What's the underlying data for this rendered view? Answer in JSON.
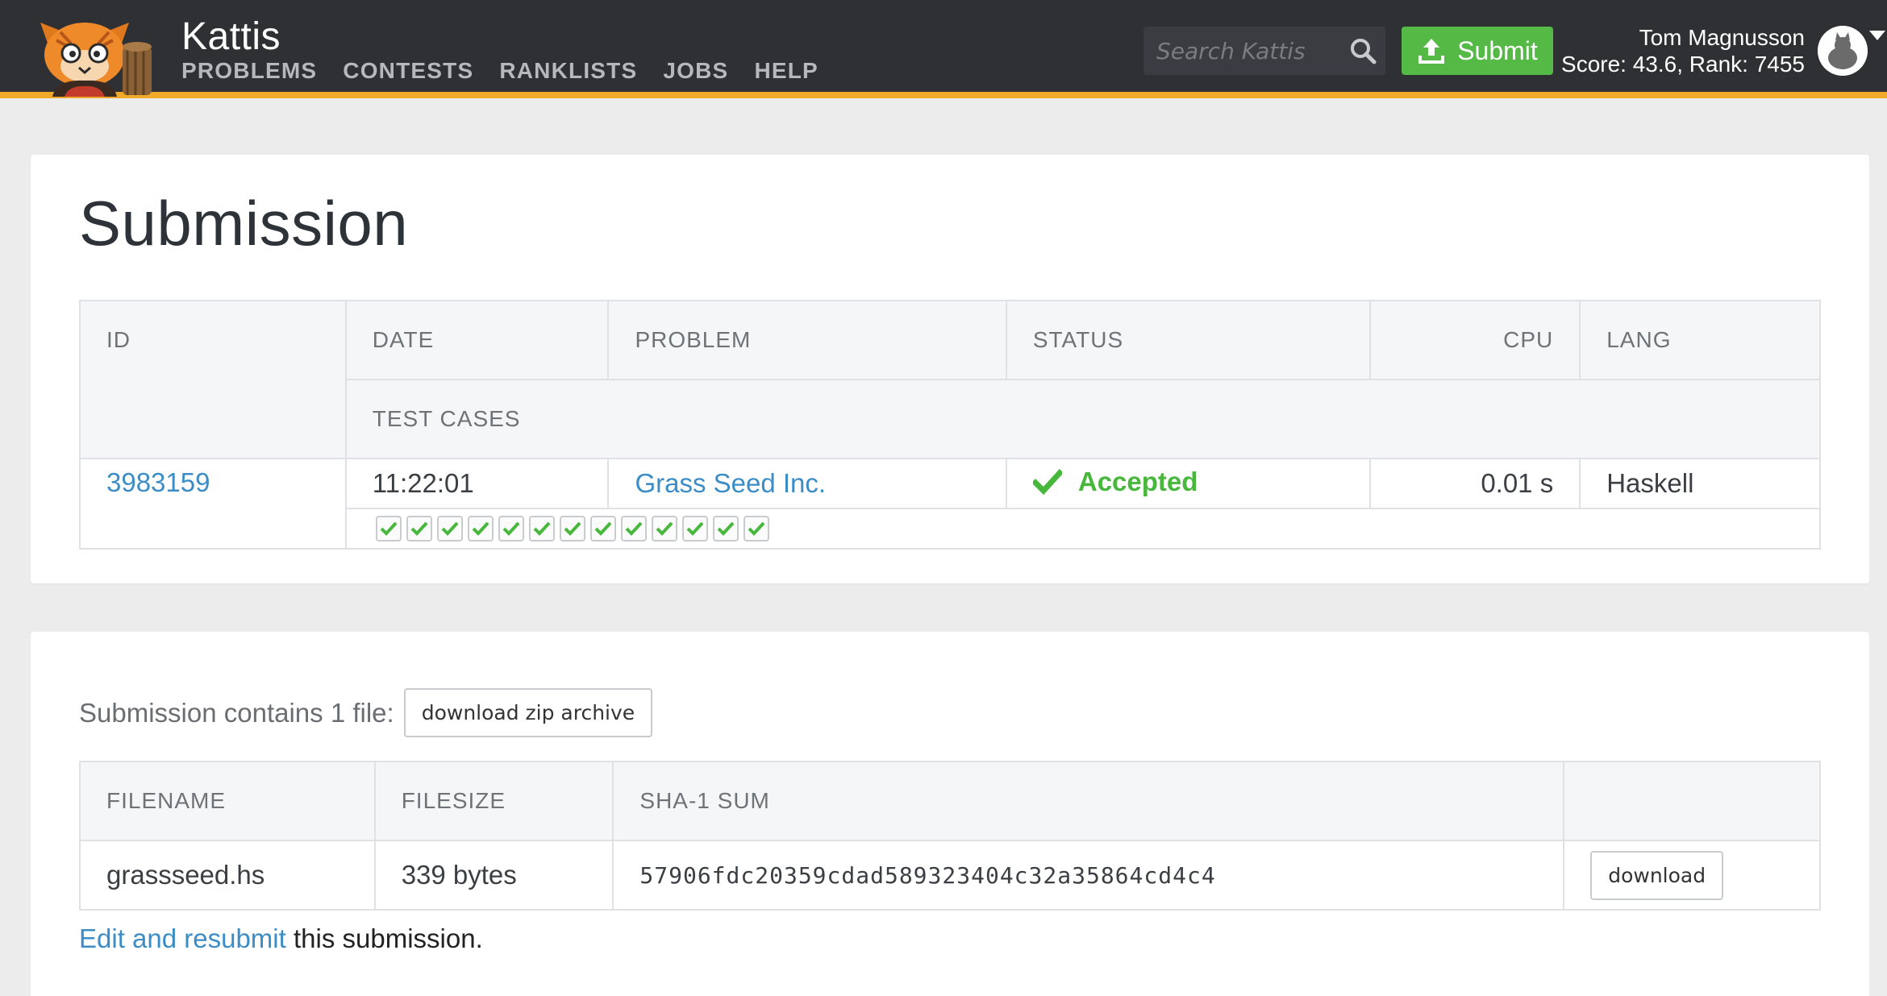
{
  "header": {
    "brand": "Kattis",
    "nav": [
      "PROBLEMS",
      "CONTESTS",
      "RANKLISTS",
      "JOBS",
      "HELP"
    ],
    "search_placeholder": "Search Kattis",
    "submit_label": "Submit",
    "user_name": "Tom Magnusson",
    "user_score": "Score: 43.6, Rank: 7455",
    "accent_color": "#f0a928",
    "submit_color": "#55b946"
  },
  "submission": {
    "title": "Submission",
    "columns": {
      "id": "ID",
      "date": "DATE",
      "problem": "PROBLEM",
      "status": "STATUS",
      "cpu": "CPU",
      "lang": "LANG",
      "test_cases": "TEST CASES"
    },
    "row": {
      "id": "3983159",
      "date": "11:22:01",
      "problem": "Grass Seed Inc.",
      "status": "Accepted",
      "cpu": "0.01 s",
      "lang": "Haskell"
    },
    "test_cases_passed": 13,
    "test_case_icon": "check-icon",
    "status_color": "#47b83b"
  },
  "files": {
    "intro": "Submission contains 1 file:",
    "zip_button": "download zip archive",
    "columns": {
      "filename": "FILENAME",
      "filesize": "FILESIZE",
      "sha": "SHA-1 SUM"
    },
    "rows": [
      {
        "filename": "grassseed.hs",
        "filesize": "339 bytes",
        "sha": "57906fdc20359cdad589323404c32a35864cd4c4",
        "download": "download"
      }
    ]
  },
  "footer": {
    "edit_link": "Edit and resubmit",
    "edit_rest": " this submission."
  }
}
